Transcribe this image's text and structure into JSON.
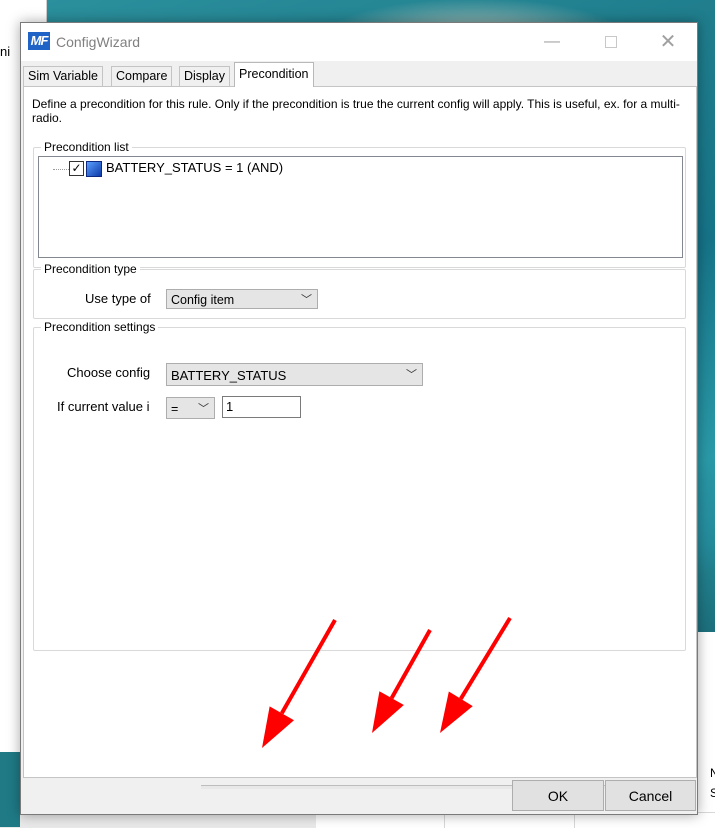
{
  "background": {
    "left_window_fragment": "ni",
    "right_panel_fragments": [
      "N",
      "S"
    ]
  },
  "dialog": {
    "title": "ConfigWizard",
    "app_icon_text": "MF",
    "tabs": [
      "Sim Variable",
      "Compare",
      "Display",
      "Precondition"
    ],
    "active_tab": "Precondition",
    "description": "Define a precondition for this rule. Only if the precondition is true the current config will apply. This is useful, ex. for a multi-radio.",
    "precondition_list": {
      "legend": "Precondition list",
      "items": [
        {
          "label": "BATTERY_STATUS = 1  (AND)",
          "checked": true,
          "check_glyph": "✓"
        }
      ]
    },
    "precondition_type": {
      "legend": "Precondition type",
      "use_type_label": "Use type of",
      "use_type_value": "Config item"
    },
    "precondition_settings": {
      "legend": "Precondition settings",
      "choose_config_label": "Choose config",
      "choose_config_value": "BATTERY_STATUS",
      "current_value_label": "If current value i",
      "operator_value": "=",
      "compare_value": "1"
    },
    "buttons": {
      "ok": "OK",
      "cancel": "Cancel"
    }
  },
  "annotation": {
    "arrow_color": "#ff0000",
    "arrow_count": 3
  }
}
